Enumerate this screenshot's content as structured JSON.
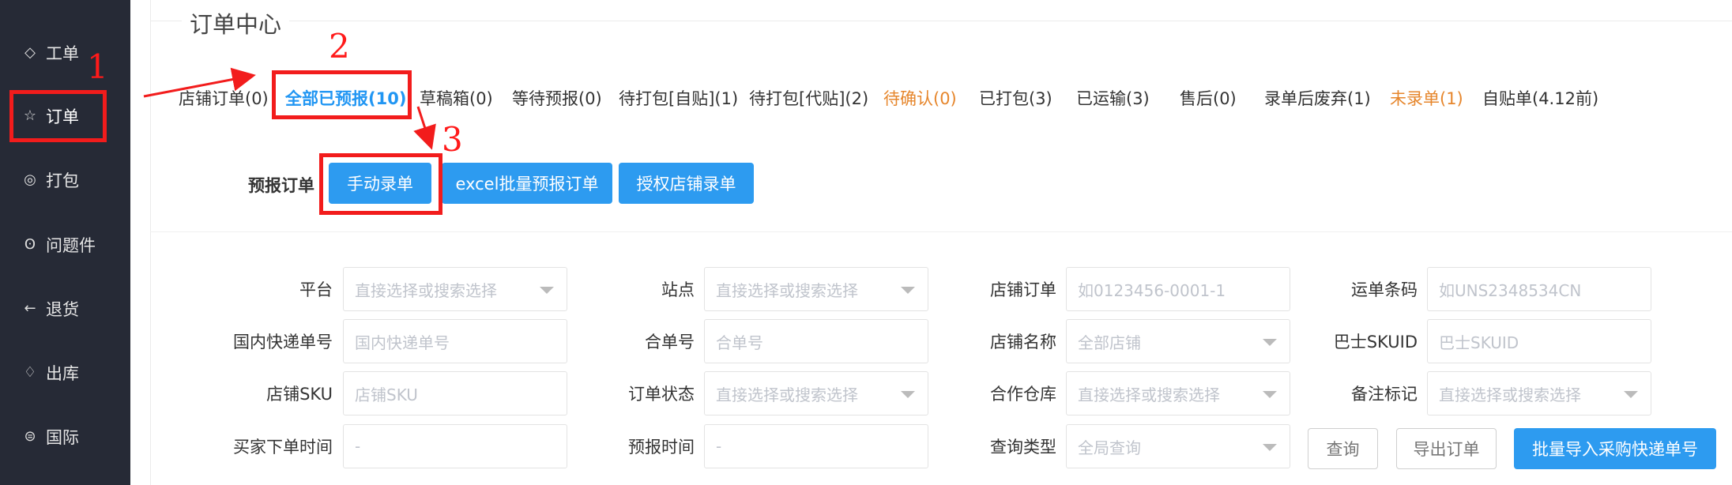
{
  "sidebar": {
    "items": [
      {
        "label": "工单",
        "icon": "diamond-icon"
      },
      {
        "label": "订单",
        "icon": "star-icon"
      },
      {
        "label": "打包",
        "icon": "eye-code-icon"
      },
      {
        "label": "问题件",
        "icon": "flame-icon"
      },
      {
        "label": "退货",
        "icon": "arrow-left-icon"
      },
      {
        "label": "出库",
        "icon": "drops-icon"
      },
      {
        "label": "国际",
        "icon": "globe-icon"
      }
    ]
  },
  "section": {
    "title": "订单中心"
  },
  "tabs": [
    {
      "label": "店铺订单(0)"
    },
    {
      "label": "全部已预报(10)"
    },
    {
      "label": "草稿箱(0)"
    },
    {
      "label": "等待预报(0)"
    },
    {
      "label": "待打包[自贴](1)"
    },
    {
      "label": "待打包[代贴](2)"
    },
    {
      "label": "待确认(0)"
    },
    {
      "label": "已打包(3)"
    },
    {
      "label": "已运输(3)"
    },
    {
      "label": "售后(0)"
    },
    {
      "label": "录单后废弃(1)"
    },
    {
      "label": "未录单(1)"
    },
    {
      "label": "自贴单(4.12前)"
    }
  ],
  "preorder": {
    "label": "预报订单",
    "buttons": [
      "手动录单",
      "excel批量预报订单",
      "授权店铺录单"
    ]
  },
  "filters": {
    "platform": {
      "label": "平台",
      "placeholder": "直接选择或搜索选择"
    },
    "site": {
      "label": "站点",
      "placeholder": "直接选择或搜索选择"
    },
    "shop_order": {
      "label": "店铺订单",
      "placeholder": "如0123456-0001-1"
    },
    "waybill": {
      "label": "运单条码",
      "placeholder": "如UNS2348534CN"
    },
    "domestic": {
      "label": "国内快递单号",
      "placeholder": "国内快递单号"
    },
    "combined": {
      "label": "合单号",
      "placeholder": "合单号"
    },
    "shop_name": {
      "label": "店铺名称",
      "placeholder": "全部店铺"
    },
    "bashi": {
      "label": "巴士SKUID",
      "placeholder": "巴士SKUID"
    },
    "shop_sku": {
      "label": "店铺SKU",
      "placeholder": "店铺SKU"
    },
    "order_status": {
      "label": "订单状态",
      "placeholder": "直接选择或搜索选择"
    },
    "warehouse": {
      "label": "合作仓库",
      "placeholder": "直接选择或搜索选择"
    },
    "remark": {
      "label": "备注标记",
      "placeholder": "直接选择或搜索选择"
    },
    "buyer_time": {
      "label": "买家下单时间",
      "placeholder": "-"
    },
    "pre_time": {
      "label": "预报时间",
      "placeholder": "-"
    },
    "query_type": {
      "label": "查询类型",
      "placeholder": "全局查询"
    }
  },
  "actions": {
    "query": "查询",
    "export": "导出订单",
    "batch_import": "批量导入采购快递单号"
  },
  "annotations": {
    "one": "1",
    "two": "2",
    "three": "3"
  },
  "colors": {
    "primary": "#2d9bf0",
    "sidebar": "#262a36",
    "annotation": "#f21c1c",
    "orange": "#e6862c"
  }
}
